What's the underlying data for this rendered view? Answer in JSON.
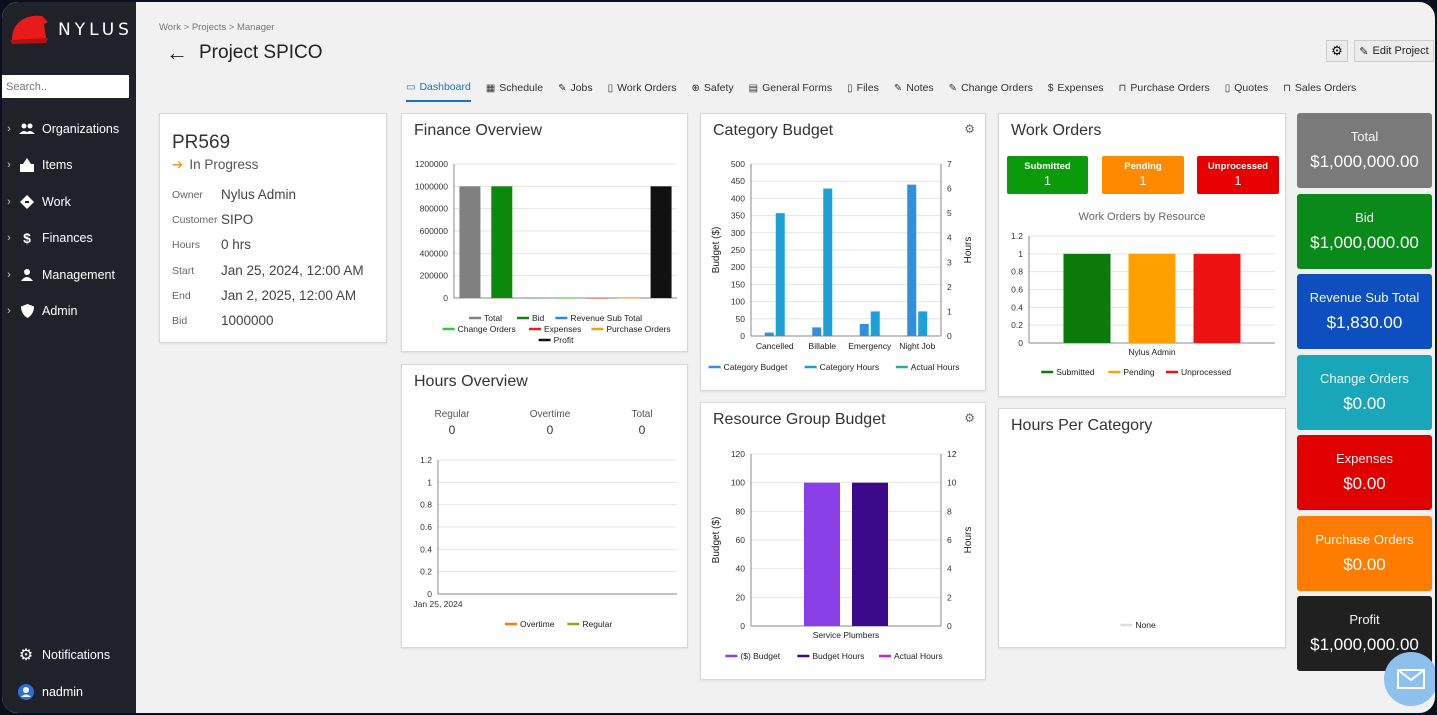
{
  "app": {
    "brand": "NYLUS"
  },
  "sidebar": {
    "search_placeholder": "Search..",
    "items": [
      {
        "label": "Organizations",
        "icon": "people-icon"
      },
      {
        "label": "Items",
        "icon": "items-icon"
      },
      {
        "label": "Work",
        "icon": "work-icon"
      },
      {
        "label": "Finances",
        "icon": "dollar-icon"
      },
      {
        "label": "Management",
        "icon": "person-icon"
      },
      {
        "label": "Admin",
        "icon": "shield-icon"
      }
    ],
    "notifications": "Notifications",
    "user": "nadmin"
  },
  "header": {
    "breadcrumb": "Work > Projects > Manager",
    "title": "Project SPICO",
    "edit_label": "Edit Project"
  },
  "tabs": [
    {
      "label": "Dashboard",
      "icon": "▭"
    },
    {
      "label": "Schedule",
      "icon": "▦"
    },
    {
      "label": "Jobs",
      "icon": "✎"
    },
    {
      "label": "Work Orders",
      "icon": "▯"
    },
    {
      "label": "Safety",
      "icon": "⊕"
    },
    {
      "label": "General Forms",
      "icon": "▤"
    },
    {
      "label": "Files",
      "icon": "▯"
    },
    {
      "label": "Notes",
      "icon": "✎"
    },
    {
      "label": "Change Orders",
      "icon": "✎"
    },
    {
      "label": "Expenses",
      "icon": "$"
    },
    {
      "label": "Purchase Orders",
      "icon": "⊓"
    },
    {
      "label": "Quotes",
      "icon": "▯"
    },
    {
      "label": "Sales Orders",
      "icon": "⊓"
    }
  ],
  "project": {
    "id": "PR569",
    "status": "In Progress",
    "fields": [
      {
        "label": "Owner",
        "value": "Nylus Admin"
      },
      {
        "label": "Customer",
        "value": "SIPO"
      },
      {
        "label": "Hours",
        "value": "0 hrs"
      },
      {
        "label": "Start",
        "value": "Jan 25, 2024, 12:00 AM"
      },
      {
        "label": "End",
        "value": "Jan 2, 2025, 12:00 AM"
      },
      {
        "label": "Bid",
        "value": "1000000"
      }
    ]
  },
  "finance_overview": {
    "title": "Finance Overview"
  },
  "hours_overview": {
    "title": "Hours Overview",
    "regular_label": "Regular",
    "regular_value": "0",
    "overtime_label": "Overtime",
    "overtime_value": "0",
    "total_label": "Total",
    "total_value": "0"
  },
  "category_budget": {
    "title": "Category Budget"
  },
  "resource_group_budget": {
    "title": "Resource Group Budget"
  },
  "work_orders": {
    "title": "Work Orders",
    "badges": [
      {
        "label": "Submitted",
        "value": "1",
        "color": "#0a9a0a"
      },
      {
        "label": "Pending",
        "value": "1",
        "color": "#ff8a00"
      },
      {
        "label": "Unprocessed",
        "value": "1",
        "color": "#e60000"
      }
    ]
  },
  "hours_per_category": {
    "title": "Hours Per Category"
  },
  "stats": [
    {
      "label": "Total",
      "value": "$1,000,000.00",
      "color": "#7a7a7a"
    },
    {
      "label": "Bid",
      "value": "$1,000,000.00",
      "color": "#0a8a1a"
    },
    {
      "label": "Revenue Sub Total",
      "value": "$1,830.00",
      "color": "#0d4fc0"
    },
    {
      "label": "Change Orders",
      "value": "$0.00",
      "color": "#17a7b8"
    },
    {
      "label": "Expenses",
      "value": "$0.00",
      "color": "#e00000"
    },
    {
      "label": "Purchase Orders",
      "value": "$0.00",
      "color": "#ff7c00"
    },
    {
      "label": "Profit",
      "value": "$1,000,000.00",
      "color": "#202020"
    }
  ],
  "chart_data": [
    {
      "id": "finance",
      "type": "bar",
      "title": "Finance Overview",
      "ylim": [
        0,
        1200000
      ],
      "yticks": [
        "1200000",
        "1000000",
        "800000",
        "600000",
        "400000",
        "200000",
        "0"
      ],
      "series": [
        {
          "name": "Total",
          "value": 1000000,
          "color": "#808080"
        },
        {
          "name": "Bid",
          "value": 1000000,
          "color": "#0a8a0a"
        },
        {
          "name": "Revenue Sub Total",
          "value": 1830,
          "color": "#1f8fd8"
        },
        {
          "name": "Change Orders",
          "value": 0,
          "color": "#34c734"
        },
        {
          "name": "Expenses",
          "value": 0,
          "color": "#e52020"
        },
        {
          "name": "Purchase Orders",
          "value": 0,
          "color": "#f0a020"
        },
        {
          "name": "Profit",
          "value": 1000000,
          "color": "#111111"
        }
      ]
    },
    {
      "id": "hours",
      "type": "line",
      "title": "Hours Overview",
      "ylim": [
        0,
        1.2
      ],
      "yticks": [
        "1.2",
        "1",
        "0.8",
        "0.6",
        "0.4",
        "0.2",
        "0"
      ],
      "x": [
        "Jan 25, 2024"
      ],
      "series": [
        {
          "name": "Overtime",
          "color": "#f07820",
          "values": []
        },
        {
          "name": "Regular",
          "color": "#9aa020",
          "values": []
        }
      ]
    },
    {
      "id": "category",
      "type": "bar",
      "title": "Category Budget",
      "ylabel": "Budget ($)",
      "y2label": "Hours",
      "ylim": [
        0,
        500
      ],
      "y2lim": [
        0,
        7
      ],
      "yticks": [
        "500",
        "450",
        "400",
        "350",
        "300",
        "250",
        "200",
        "150",
        "100",
        "50",
        "0"
      ],
      "y2ticks": [
        "7",
        "6",
        "5",
        "4",
        "3",
        "2",
        "1",
        "0"
      ],
      "categories": [
        "Cancelled",
        "Billable",
        "Emergency",
        "Night Job"
      ],
      "series": [
        {
          "name": "Category Budget",
          "color": "#2f8fe0",
          "values": [
            10,
            25,
            35,
            440
          ]
        },
        {
          "name": "Category Hours",
          "color": "#1ca0d8",
          "values": [
            5,
            6,
            1,
            1
          ]
        },
        {
          "name": "Actual Hours",
          "color": "#1ab3a6",
          "values": [
            0,
            0,
            0,
            0
          ]
        }
      ]
    },
    {
      "id": "resource",
      "type": "bar",
      "title": "Resource Group Budget",
      "ylabel": "Budget ($)",
      "y2label": "Hours",
      "ylim": [
        0,
        120
      ],
      "y2lim": [
        0,
        12
      ],
      "yticks": [
        "120",
        "100",
        "80",
        "60",
        "40",
        "20",
        "0"
      ],
      "y2ticks": [
        "12",
        "10",
        "8",
        "6",
        "4",
        "2",
        "0"
      ],
      "categories": [
        "Service Plumbers"
      ],
      "series": [
        {
          "name": "($) Budget",
          "color": "#8a3ee8",
          "values": [
            100
          ]
        },
        {
          "name": "Budget Hours",
          "color": "#3a0a8a",
          "values": [
            10
          ]
        },
        {
          "name": "Actual Hours",
          "color": "#cc22cc",
          "values": [
            0
          ]
        }
      ]
    },
    {
      "id": "workorders",
      "type": "bar",
      "title": "Work Orders by Resource",
      "ylim": [
        0,
        1.2
      ],
      "yticks": [
        "1.2",
        "1",
        "0.8",
        "0.6",
        "0.4",
        "0.2",
        "0"
      ],
      "categories": [
        "Nylus Admin"
      ],
      "series": [
        {
          "name": "Submitted",
          "color": "#0a7a0a",
          "values": [
            1
          ]
        },
        {
          "name": "Pending",
          "color": "#ffa000",
          "values": [
            1
          ]
        },
        {
          "name": "Unprocessed",
          "color": "#ee1111",
          "values": [
            1
          ]
        }
      ]
    },
    {
      "id": "hourspercat",
      "type": "pie",
      "title": "Hours Per Category",
      "series": [
        {
          "name": "None",
          "color": "#dddddd",
          "values": []
        }
      ]
    }
  ]
}
